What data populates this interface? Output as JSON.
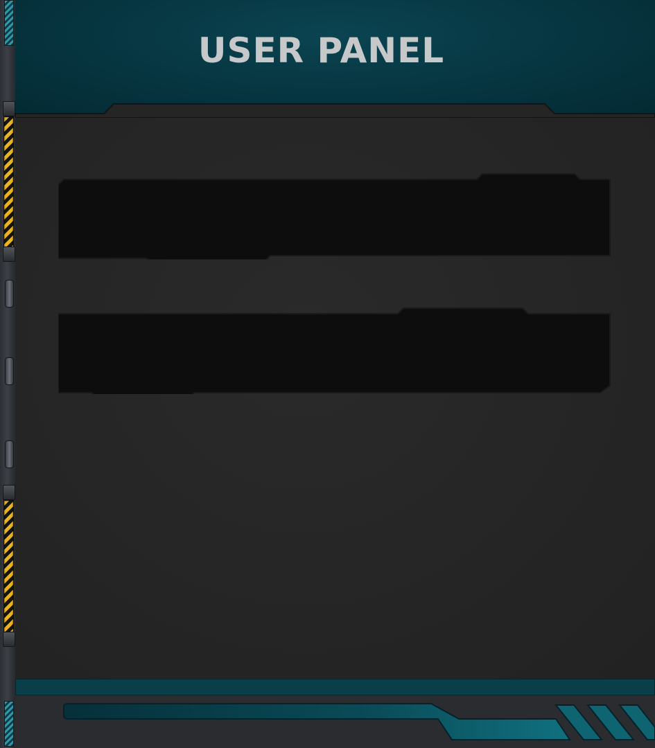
{
  "panel": {
    "title": "USER PANEL"
  },
  "fields": [
    {
      "value": "",
      "placeholder": ""
    },
    {
      "value": "",
      "placeholder": ""
    }
  ],
  "colors": {
    "header_teal": "#063540",
    "body_gray": "#252525",
    "field_black": "#0d0d0d",
    "title_text": "#c6c8c9",
    "accent_teal": "#0f5f6d",
    "hazard_yellow": "#e9b421"
  }
}
